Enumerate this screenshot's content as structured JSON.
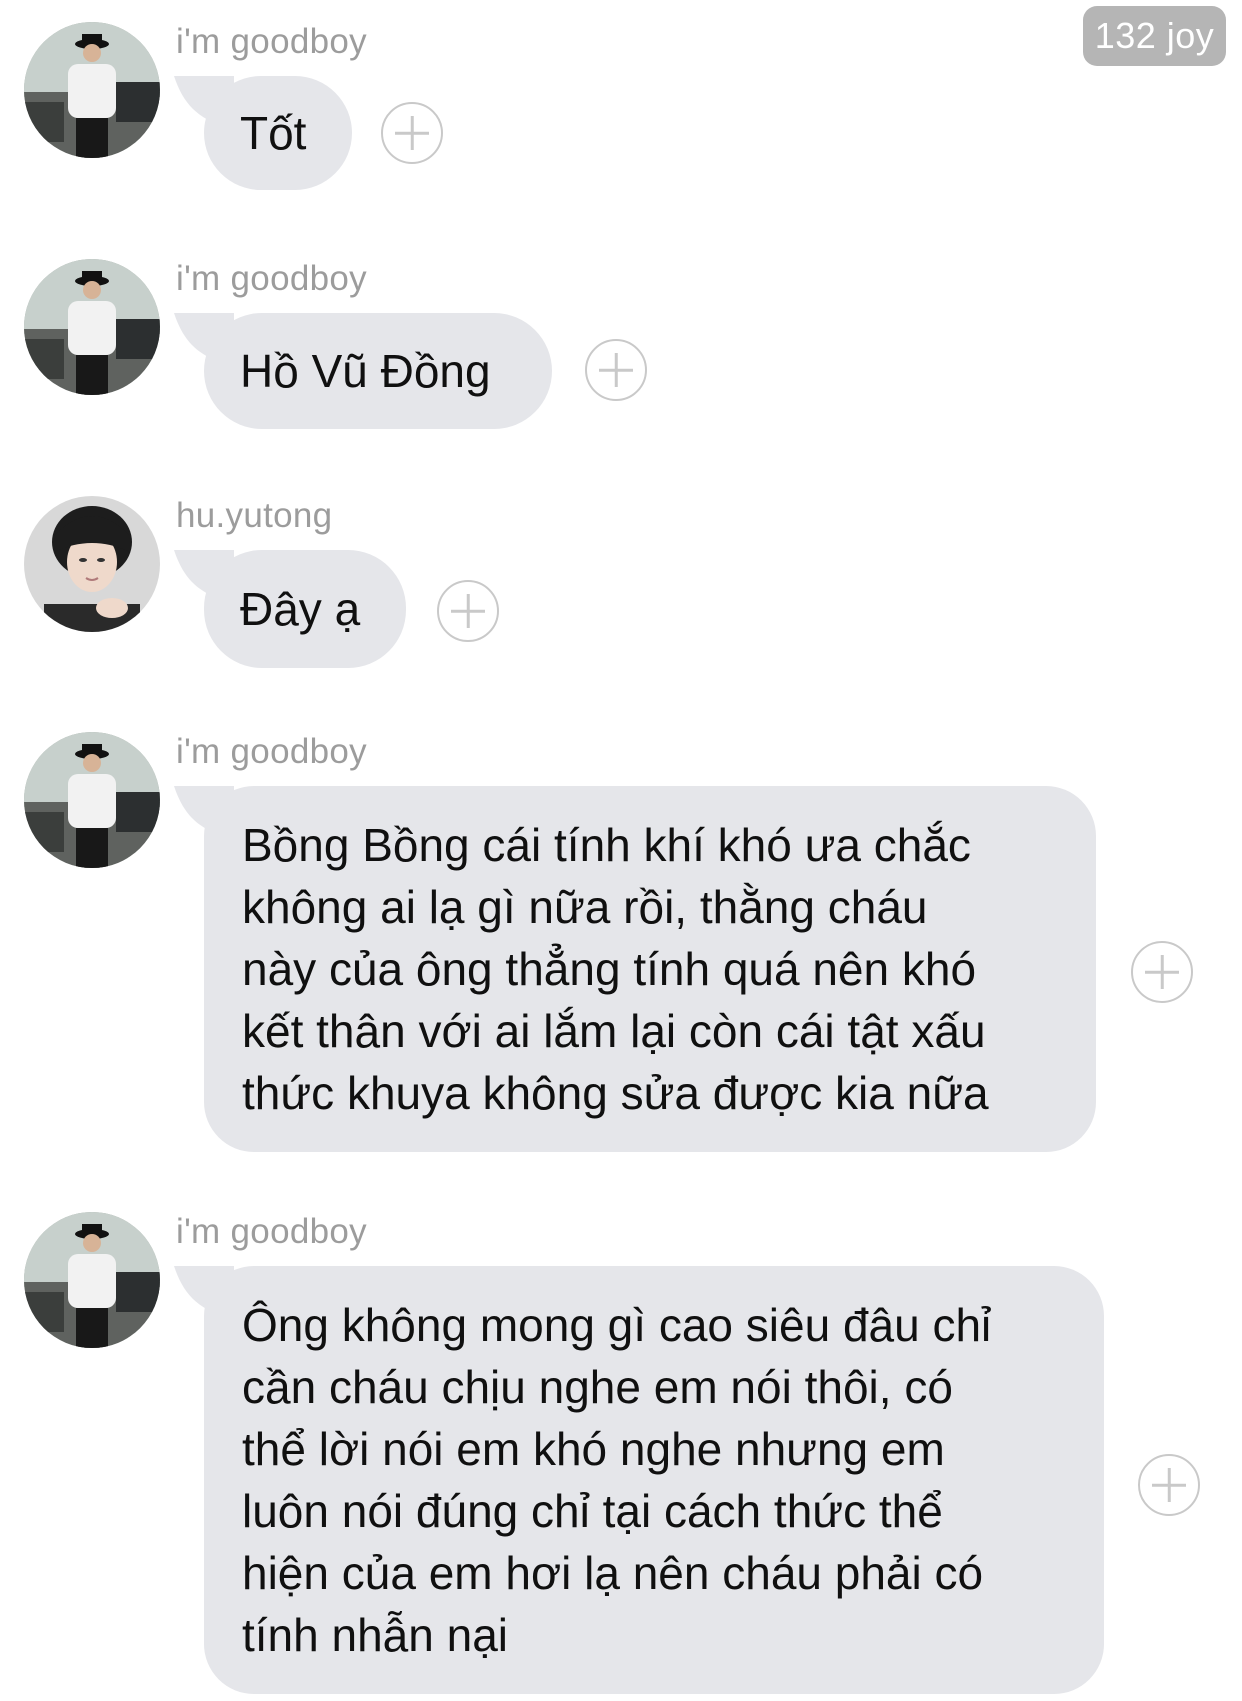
{
  "badge": {
    "text": "132 joy"
  },
  "messages": [
    {
      "sender": "i'm goodboy",
      "avatar": "goodboy-avatar",
      "text": "Tốt"
    },
    {
      "sender": "i'm goodboy",
      "avatar": "goodboy-avatar",
      "text": "Hồ Vũ Đồng"
    },
    {
      "sender": "hu.yutong",
      "avatar": "yutong-avatar",
      "text": "Đây ạ"
    },
    {
      "sender": "i'm goodboy",
      "avatar": "goodboy-avatar",
      "lines": [
        "Bồng Bồng cái tính khí khó ưa chắc",
        "không ai lạ gì nữa rồi, thằng cháu",
        "này của ông thẳng tính quá nên khó",
        "kết thân với ai lắm lại còn cái tật xấu",
        "thức khuya không sửa được kia nữa"
      ]
    },
    {
      "sender": "i'm goodboy",
      "avatar": "goodboy-avatar",
      "lines": [
        "Ông không mong gì cao siêu đâu chỉ",
        "cần cháu chịu nghe em nói thôi, có",
        "thể lời nói em khó nghe nhưng em",
        "luôn nói đúng chỉ tại cách thức thể",
        "hiện của em hơi lạ nên cháu phải có",
        "tính nhẫn nại"
      ]
    }
  ],
  "colors": {
    "bubble": "#e5e6ea",
    "sender_text": "#9c9c9c",
    "badge_bg": "#b5b5b5",
    "add_icon": "#c9c9c9"
  }
}
